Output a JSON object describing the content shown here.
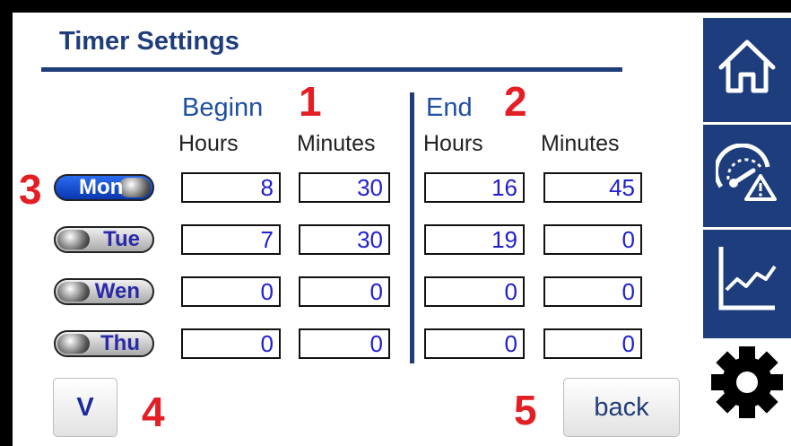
{
  "header": {
    "title": "Timer Settings"
  },
  "columns": {
    "begin_label": "Beginn",
    "end_label": "End",
    "hours_label": "Hours",
    "minutes_label": "Minutes"
  },
  "annotations": [
    "1",
    "2",
    "3",
    "4",
    "5"
  ],
  "rows": [
    {
      "day": "Mon",
      "active": true,
      "begin_hours": "8",
      "begin_minutes": "30",
      "end_hours": "16",
      "end_minutes": "45"
    },
    {
      "day": "Tue",
      "active": false,
      "begin_hours": "7",
      "begin_minutes": "30",
      "end_hours": "19",
      "end_minutes": "0"
    },
    {
      "day": "Wen",
      "active": false,
      "begin_hours": "0",
      "begin_minutes": "0",
      "end_hours": "0",
      "end_minutes": "0"
    },
    {
      "day": "Thu",
      "active": false,
      "begin_hours": "0",
      "begin_minutes": "0",
      "end_hours": "0",
      "end_minutes": "0"
    }
  ],
  "buttons": {
    "scroll_down_label": "V",
    "back_label": "back"
  },
  "sidebar": {
    "items": [
      {
        "icon": "home-icon"
      },
      {
        "icon": "gauge-warning-icon"
      },
      {
        "icon": "chart-icon"
      },
      {
        "icon": "gear-icon",
        "selected": true
      }
    ]
  },
  "colors": {
    "accent": "#1d3d7d",
    "value_text": "#1f1fd0",
    "annotation": "#e31e24"
  }
}
